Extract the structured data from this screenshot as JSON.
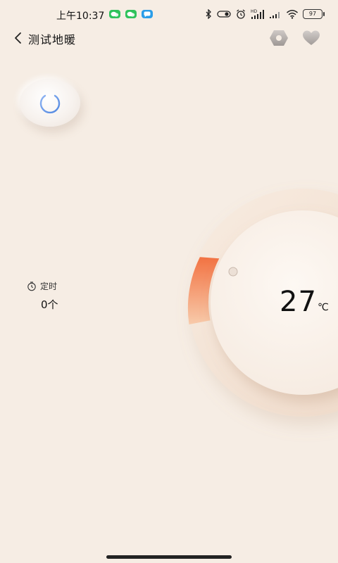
{
  "status_bar": {
    "time": "上午10:37",
    "battery": "97",
    "icons": [
      "wechat-icon",
      "wechat-icon",
      "message-icon",
      "bluetooth-icon",
      "toggle-icon",
      "alarm-icon",
      "hd-signal-icon",
      "signal-icon",
      "wifi-icon",
      "battery-icon"
    ]
  },
  "header": {
    "title": "测试地暖",
    "back_icon": "chevron-left-icon",
    "settings_icon": "hexagon-settings-icon",
    "favorite_icon": "heart-icon"
  },
  "power": {
    "icon": "power-icon",
    "accent": "#5b8fe0"
  },
  "timer": {
    "label": "定时",
    "count": "0个",
    "icon": "clock-icon"
  },
  "dial": {
    "temperature": "27",
    "unit": "℃",
    "accent": "#f07a45",
    "track": "#f2dccb"
  }
}
